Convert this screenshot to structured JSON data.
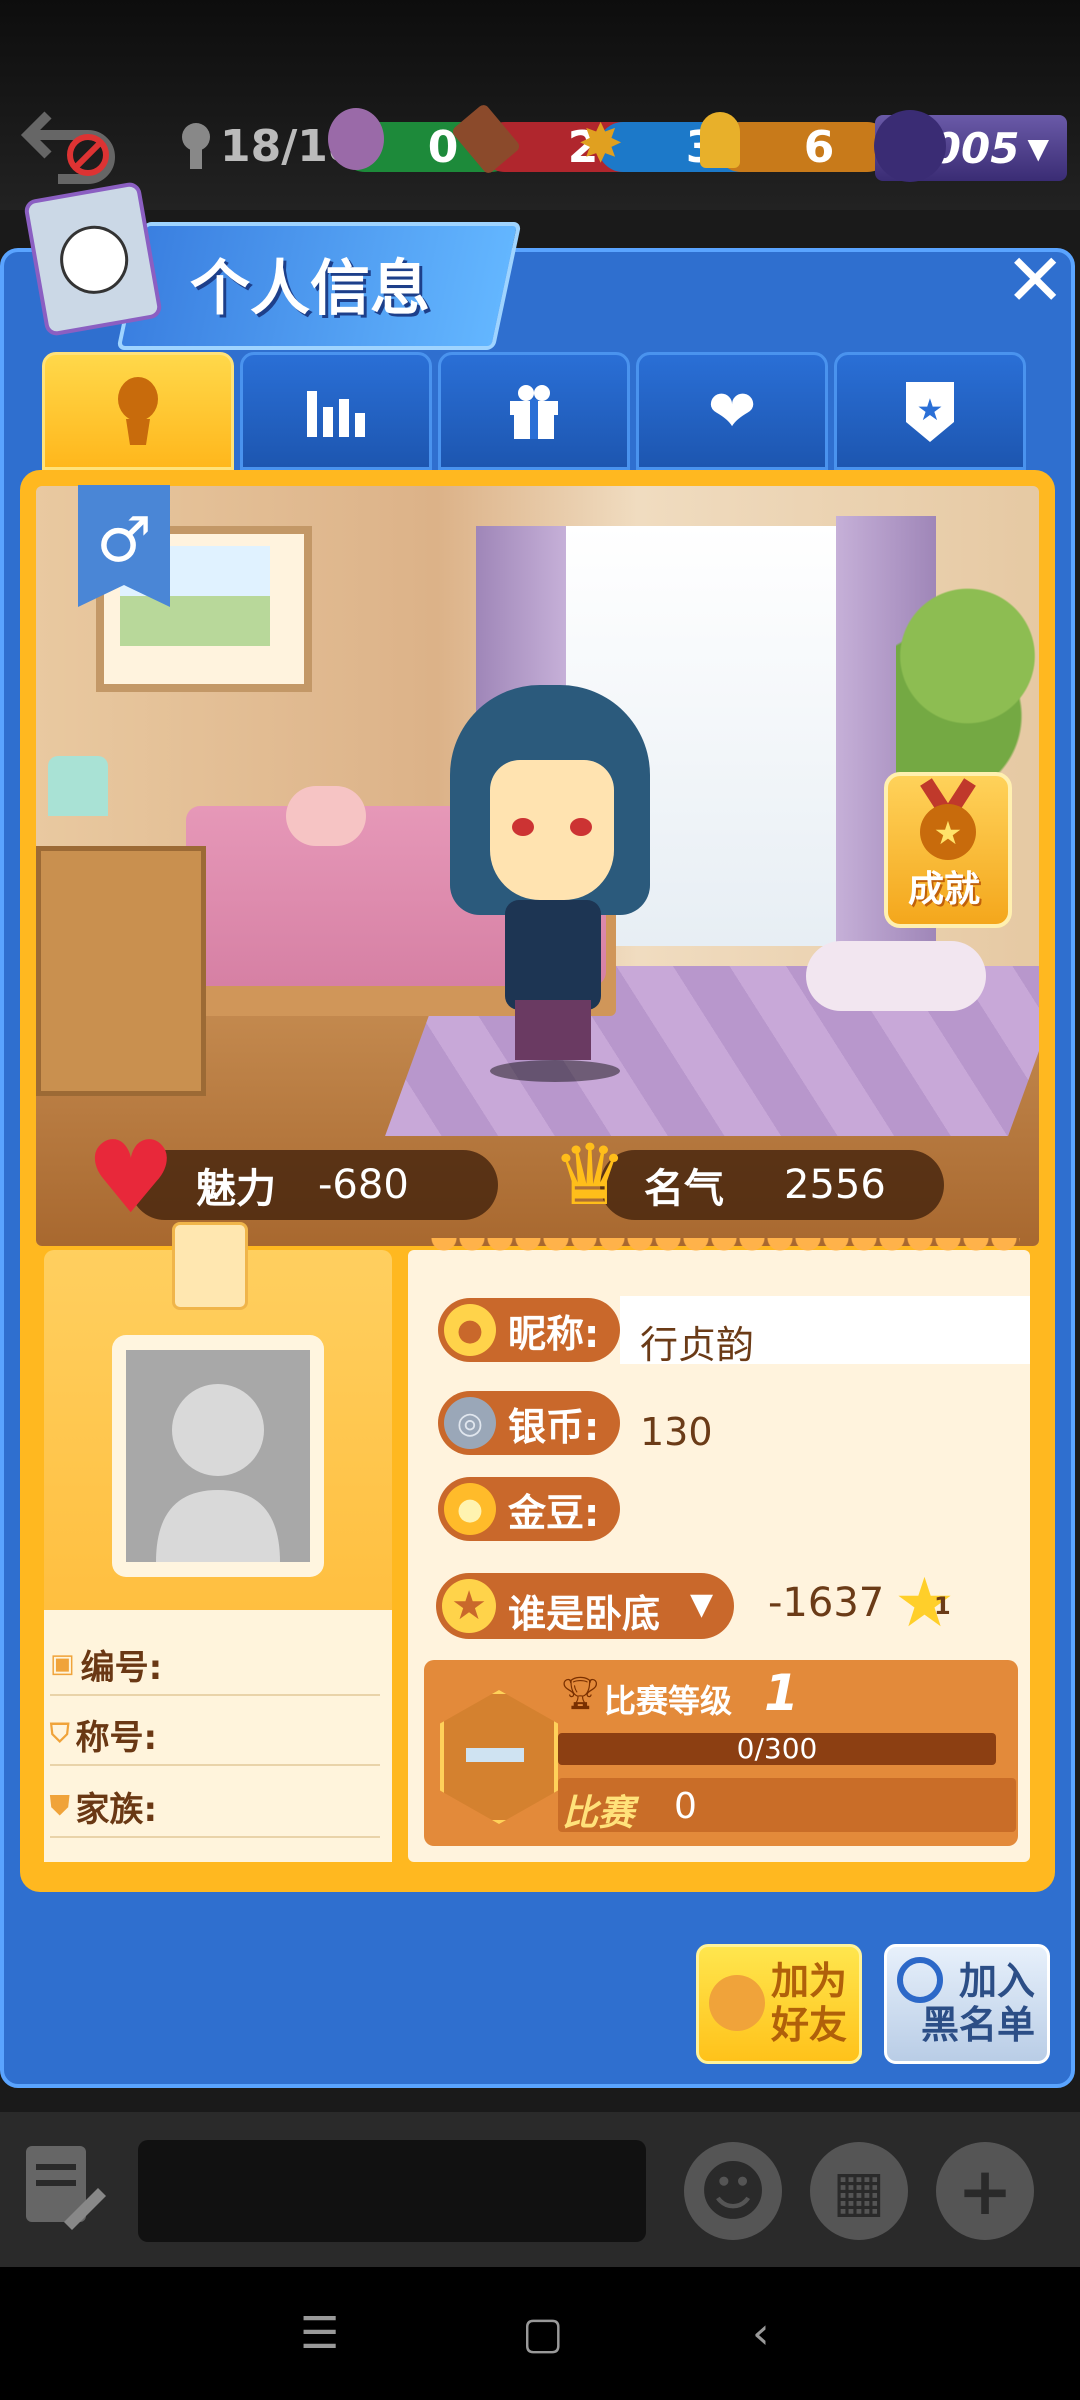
{
  "topbar": {
    "players": "18/18",
    "ghost_count": "0",
    "knife_count": "2",
    "badge_count": "3",
    "person_count": "6",
    "rank_code": "005"
  },
  "dialog": {
    "title": "个人信息",
    "close_label": "✕",
    "tabs": [
      {
        "name": "profile",
        "icon": "person-icon"
      },
      {
        "name": "stats",
        "icon": "bar-chart-icon"
      },
      {
        "name": "gifts",
        "icon": "gift-icon"
      },
      {
        "name": "relationships",
        "icon": "hearts-icon"
      },
      {
        "name": "badges",
        "icon": "shield-star-icon"
      }
    ]
  },
  "profile": {
    "gender_symbol": "♂",
    "achievement_label": "成就",
    "charm_label": "魅力",
    "charm_value": "-680",
    "fame_label": "名气",
    "fame_value": "2556",
    "id_label": "编号:",
    "title_label": "称号:",
    "family_label": "家族:",
    "nickname_label": "昵称:",
    "nickname_value": "行贞韵",
    "silver_label": "银币:",
    "silver_value": "130",
    "gold_label": "金豆:",
    "gold_value": "",
    "game_mode": "谁是卧底",
    "game_score": "-1637",
    "star_level": "1",
    "match_level_label": "比赛等级",
    "match_level_value": "1",
    "progress_text": "0/300",
    "progress_fraction": 0.0,
    "match_label": "比赛",
    "match_value": "0"
  },
  "buttons": {
    "add_friend": "加为 好友",
    "add_friend_line1": "加为",
    "add_friend_line2": "好友",
    "blacklist_line1": "加入",
    "blacklist_line2": "黑名单"
  },
  "colors": {
    "dialog_blue": "#2f6fcf",
    "frame_gold": "#ffb820",
    "label_orange": "#c9682b"
  }
}
